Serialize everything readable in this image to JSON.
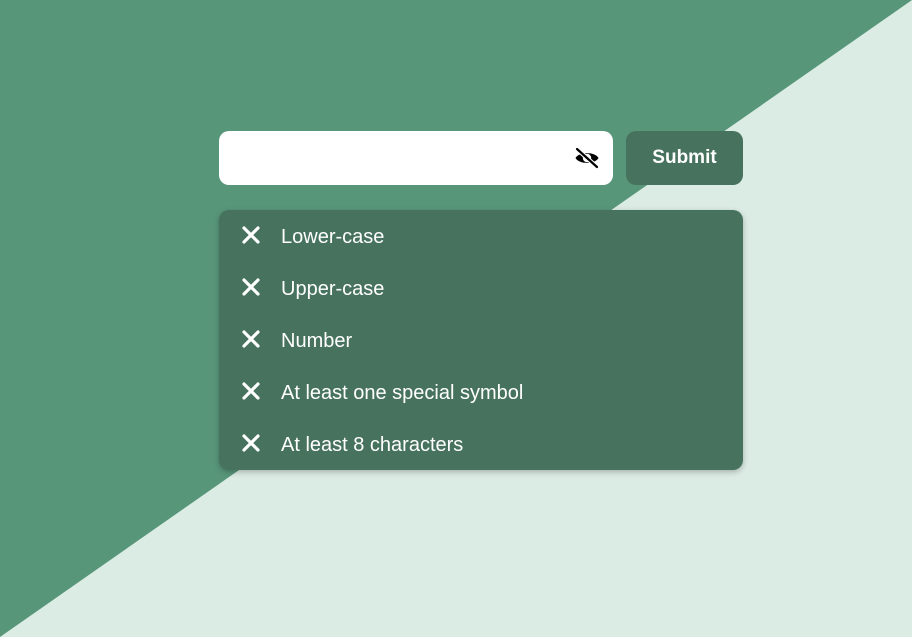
{
  "colors": {
    "background_dark": "#58967a",
    "background_light": "#dbece4",
    "accent": "#47735e",
    "text_light": "#ffffff",
    "field_bg": "#ffffff"
  },
  "password_field": {
    "value": "",
    "placeholder": "",
    "toggle_icon": "eye-slash-icon"
  },
  "submit": {
    "label": "Submit"
  },
  "requirements": {
    "status_icon": "x-mark-icon",
    "items": [
      {
        "label": "Lower-case",
        "met": false
      },
      {
        "label": "Upper-case",
        "met": false
      },
      {
        "label": "Number",
        "met": false
      },
      {
        "label": "At least one special symbol",
        "met": false
      },
      {
        "label": "At least 8 characters",
        "met": false
      }
    ]
  }
}
